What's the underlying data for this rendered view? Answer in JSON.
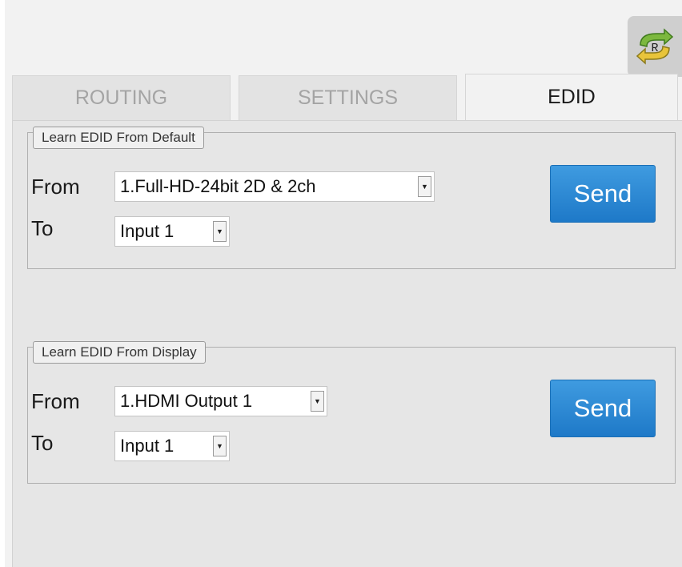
{
  "toolbar": {
    "refresh_label": "R",
    "refresh_icon": "refresh-icon"
  },
  "tabs": [
    {
      "label": "ROUTING",
      "active": false
    },
    {
      "label": "SETTINGS",
      "active": false
    },
    {
      "label": "EDID",
      "active": true
    }
  ],
  "edid": {
    "default_group": {
      "legend": "Learn EDID From Default",
      "from_label": "From",
      "from_value": "1.Full-HD-24bit 2D & 2ch",
      "to_label": "To",
      "to_value": "Input 1",
      "send_label": "Send"
    },
    "display_group": {
      "legend": "Learn EDID From Display",
      "from_label": "From",
      "from_value": "1.HDMI Output 1",
      "to_label": "To",
      "to_value": "Input 1",
      "send_label": "Send"
    }
  },
  "colors": {
    "accent": "#2a88d4",
    "active_tab_text": "#1a1a1a",
    "inactive_tab_text": "#a4a4a4",
    "refresh_arrow_green": "#5aa02c",
    "refresh_arrow_yellow": "#e8c43a"
  }
}
